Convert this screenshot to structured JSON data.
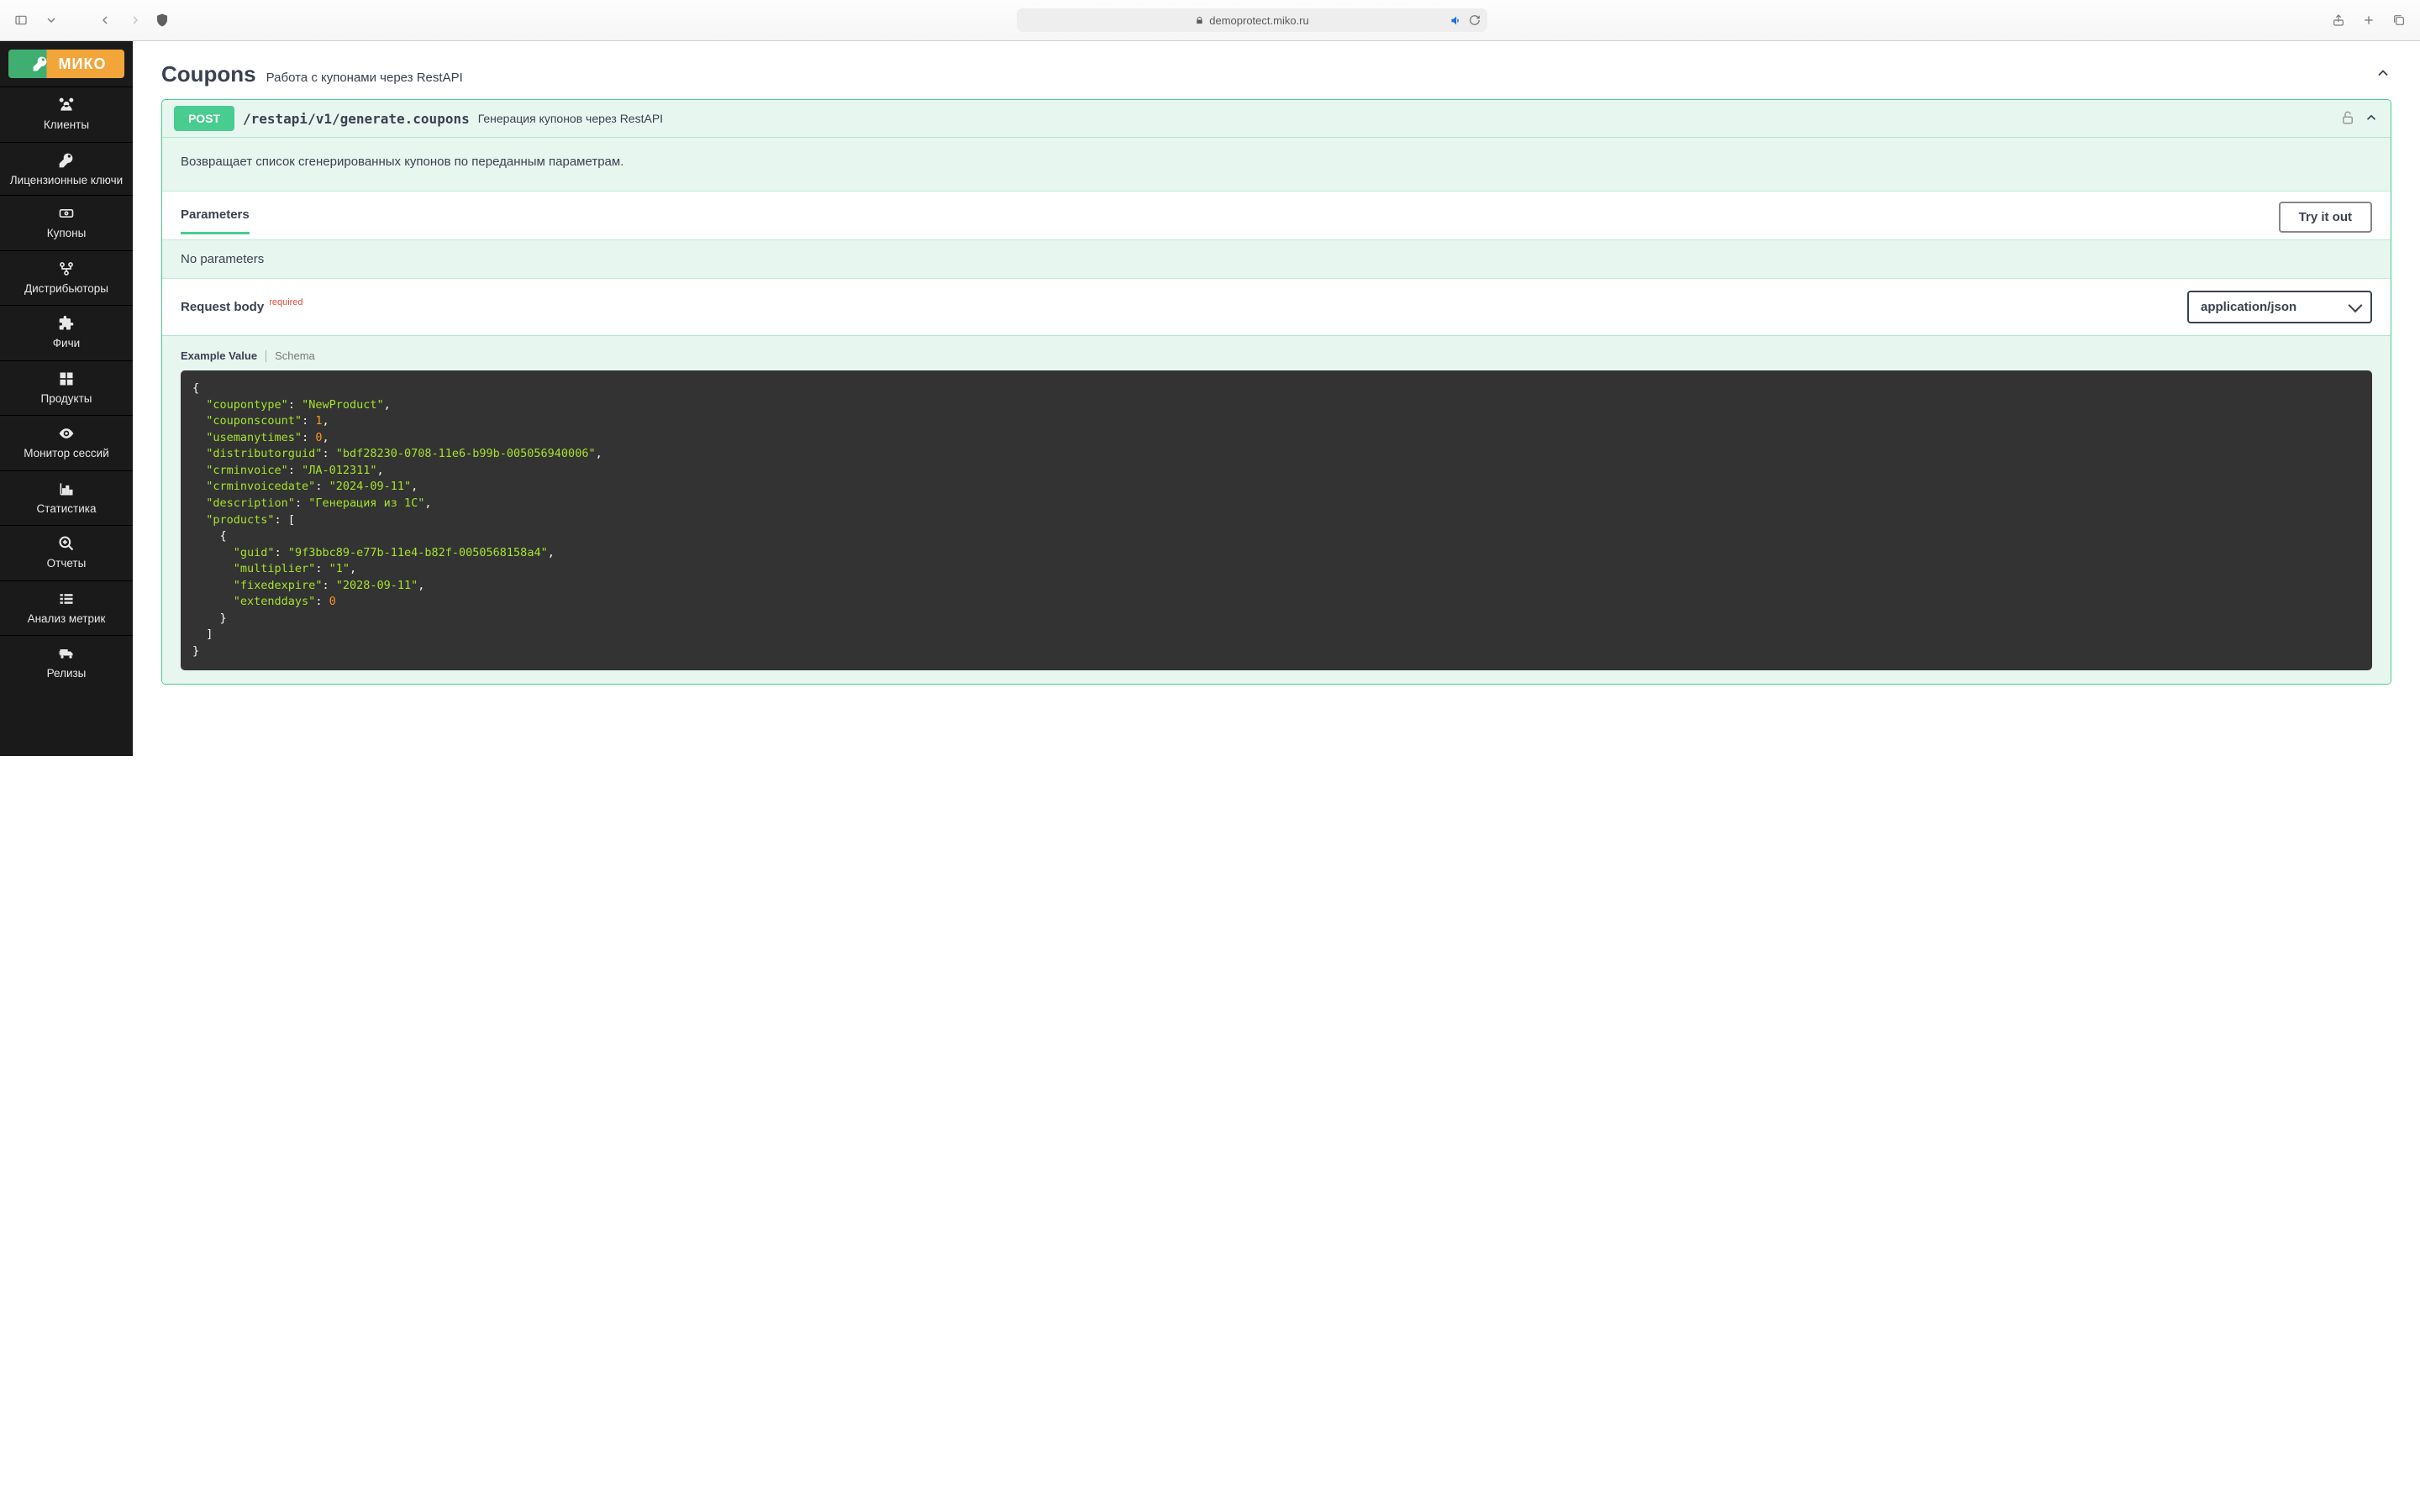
{
  "browser": {
    "url": "demoprotect.miko.ru"
  },
  "brand": {
    "name": "МИКО"
  },
  "sidebar": {
    "items": [
      {
        "label": "Клиенты",
        "icon": "users"
      },
      {
        "label": "Лицензионные ключи",
        "icon": "key"
      },
      {
        "label": "Купоны",
        "icon": "ticket"
      },
      {
        "label": "Дистрибьюторы",
        "icon": "branch"
      },
      {
        "label": "Фичи",
        "icon": "puzzle"
      },
      {
        "label": "Продукты",
        "icon": "grid"
      },
      {
        "label": "Монитор сессий",
        "icon": "eye"
      },
      {
        "label": "Статистика",
        "icon": "chart"
      },
      {
        "label": "Отчеты",
        "icon": "zoom"
      },
      {
        "label": "Анализ метрик",
        "icon": "list"
      },
      {
        "label": "Релизы",
        "icon": "truck"
      }
    ]
  },
  "section": {
    "title": "Coupons",
    "subtitle": "Работа с купонами через RestAPI"
  },
  "operation": {
    "method": "POST",
    "path": "/restapi/v1/generate.coupons",
    "summary": "Генерация купонов через RestAPI",
    "description": "Возвращает список сгенерированных купонов по переданным параметрам.",
    "parameters_tab": "Parameters",
    "try_label": "Try it out",
    "no_params": "No parameters",
    "request_body_label": "Request body",
    "required_label": "required",
    "content_type": "application/json",
    "example_tab": "Example Value",
    "schema_tab": "Schema",
    "example": {
      "coupontype": "NewProduct",
      "couponscount": 1,
      "usemanytimes": 0,
      "distributorguid": "bdf28230-0708-11e6-b99b-005056940006",
      "crminvoice": "ЛА-012311",
      "crminvoicedate": "2024-09-11",
      "description": "Генерация из 1С",
      "products": [
        {
          "guid": "9f3bbc89-e77b-11e4-b82f-0050568158a4",
          "multiplier": "1",
          "fixedexpire": "2028-09-11",
          "extenddays": 0
        }
      ]
    }
  }
}
